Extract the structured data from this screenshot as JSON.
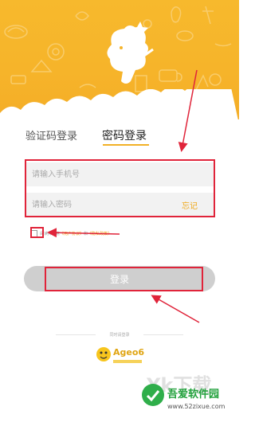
{
  "tabs": {
    "sms_login": "验证码登录",
    "password_login": "密码登录"
  },
  "form": {
    "phone_placeholder": "请输入手机号",
    "password_placeholder": "请输入密码",
    "forgot_label": "忘记"
  },
  "agreement": {
    "prefix": "阅读并同意",
    "link1": "《用户协议》",
    "middle": "和",
    "link2": "《隐私政策》"
  },
  "login_button": "登录",
  "other_login": "同时请登录",
  "partner_logo_text": "Ageo6",
  "watermark": {
    "title": "吾爱软件园",
    "url": "www.52zixue.com",
    "bg_text": "Yk下载"
  },
  "colors": {
    "brand_yellow": "#f6b42a",
    "accent_orange": "#f0a91c",
    "annotation_red": "#e0243a",
    "button_gray": "#cfcfcf"
  },
  "icons": {
    "mascot": "cartoon-character-icon",
    "checkbox": "checkbox-icon",
    "partner": "ageo-logo-icon"
  }
}
